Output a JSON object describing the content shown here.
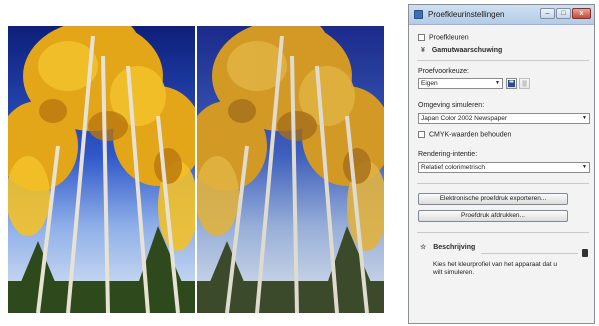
{
  "dialog": {
    "title": "Proefkleurinstellingen",
    "window_buttons": {
      "minimize": "–",
      "maximize": "□",
      "close": "x"
    },
    "proof_colors_label": "Proefkleuren",
    "gamut_warning_label": "Gamutwaarschuwing",
    "proof_preset": {
      "label": "Proefvoorkeuze:",
      "value": "Eigen"
    },
    "simulate_device": {
      "label": "Omgeving simuleren:",
      "value": "Japan Color 2002 Newspaper"
    },
    "preserve_cmyk_label": "CMYK-waarden behouden",
    "rendering_intent": {
      "label": "Rendering-intentie:",
      "value": "Relatief colorimetrisch"
    },
    "export_button": "Elektronische proefdruk exporteren...",
    "print_button": "Proefdruk afdrukken...",
    "description": {
      "title": "Beschrijving",
      "text_line1": "Kies het kleurprofiel van het apparaat dat u",
      "text_line2": "wilt simuleren."
    },
    "colors": {
      "titlebar": "#c3d7ee",
      "close_button": "#c74a3a"
    }
  }
}
